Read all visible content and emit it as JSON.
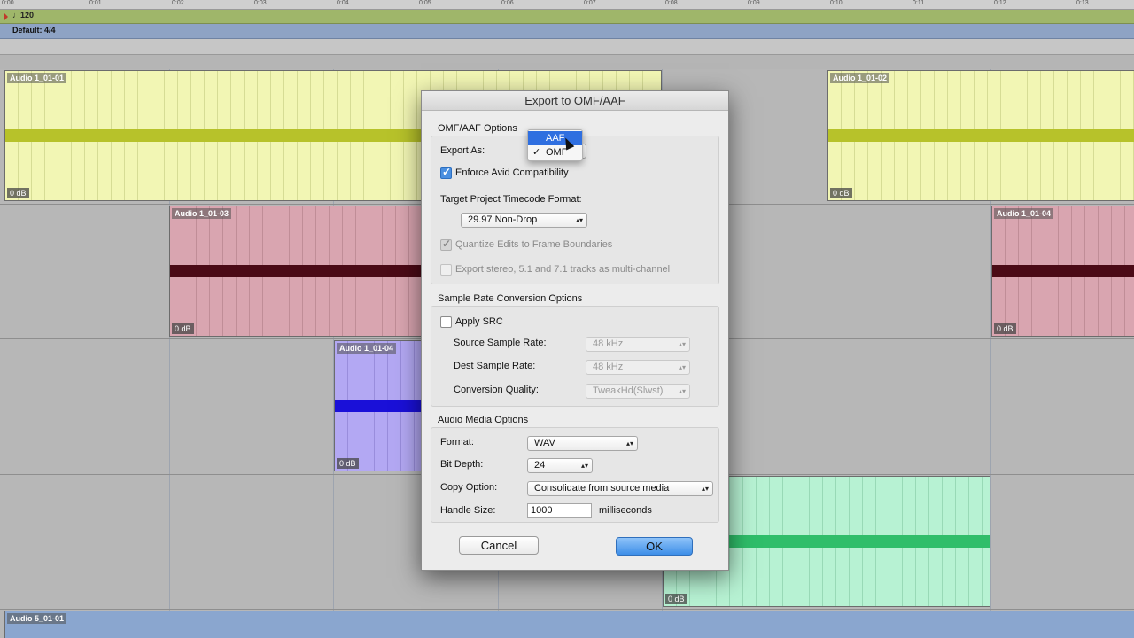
{
  "timeline": {
    "ruler_ticks": [
      "0:00",
      "0:01",
      "0:02",
      "0:03",
      "0:04",
      "0:05",
      "0:06",
      "0:07",
      "0:08",
      "0:09",
      "0:10",
      "0:11",
      "0:12",
      "0:13"
    ],
    "tempo": "♩120",
    "meter": "Default: 4/4"
  },
  "clips": [
    {
      "name": "Audio 1_01-01",
      "gain": "0 dB"
    },
    {
      "name": "Audio 1_01-02",
      "gain": "0 dB"
    },
    {
      "name": "Audio 1_01-03",
      "gain": "0 dB"
    },
    {
      "name": "Audio 1_01-04",
      "gain": "0 dB"
    },
    {
      "name": "Audio 1_01-04",
      "gain": "0 dB"
    },
    {
      "name": "",
      "gain": "0 dB"
    },
    {
      "name": "Audio 5_01-01",
      "gain": ""
    }
  ],
  "dialog": {
    "title": "Export to OMF/AAF",
    "omf_group": {
      "title": "OMF/AAF Options",
      "export_as_label": "Export As:",
      "export_as_menu": [
        "AAF",
        "OMF"
      ],
      "export_as_checked": "✓",
      "enforce_avid": "Enforce Avid Compatibility",
      "timecode_label": "Target Project Timecode Format:",
      "timecode_value": "29.97 Non-Drop",
      "quantize": "Quantize Edits to Frame Boundaries",
      "export_stereo": "Export stereo, 5.1 and 7.1 tracks as multi-channel"
    },
    "src_group": {
      "title": "Sample Rate Conversion Options",
      "apply_src": "Apply SRC",
      "source_label": "Source Sample Rate:",
      "source_value": "48 kHz",
      "dest_label": "Dest Sample Rate:",
      "dest_value": "48 kHz",
      "quality_label": "Conversion Quality:",
      "quality_value": "TweakHd(Slwst)"
    },
    "media_group": {
      "title": "Audio Media Options",
      "format_label": "Format:",
      "format_value": "WAV",
      "bitdepth_label": "Bit Depth:",
      "bitdepth_value": "24",
      "copy_label": "Copy Option:",
      "copy_value": "Consolidate from source media",
      "handle_label": "Handle Size:",
      "handle_value": "1000",
      "handle_unit": "milliseconds"
    },
    "cancel": "Cancel",
    "ok": "OK"
  },
  "colors": {
    "accent": "#2f6fe0",
    "clip_yellow": "#f2f6b4",
    "clip_pink": "#d9a5b0",
    "clip_purple": "#b3a8f3",
    "clip_mint": "#b7f2d3"
  }
}
